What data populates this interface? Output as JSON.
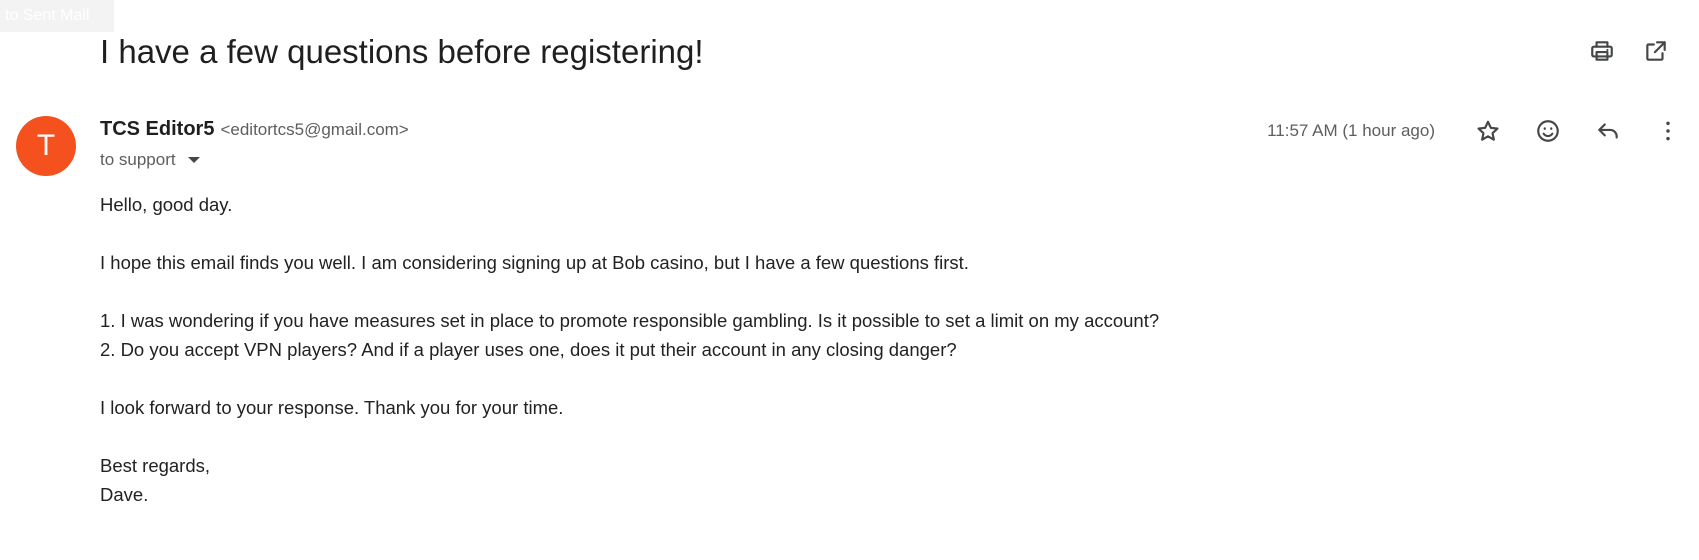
{
  "folder_label": "to Sent Mail",
  "subject": "I have a few questions before registering!",
  "top_actions": {
    "print_icon": "print-icon",
    "popout_icon": "open-in-new-window-icon"
  },
  "sender": {
    "avatar_initial": "T",
    "avatar_color": "#f4511e",
    "name": "TCS Editor5",
    "email": "<editortcs5@gmail.com>"
  },
  "recipient": "to support",
  "timestamp": "11:57 AM (1 hour ago)",
  "message_actions": [
    "star-icon",
    "emoji-reaction-icon",
    "reply-icon",
    "more-vert-icon"
  ],
  "body": {
    "greeting": "Hello, good day.",
    "intro": "I hope this email finds you well. I am considering signing up at  Bob casino, but I have a few questions first.",
    "q1": "1. I was wondering if you have measures set in place to promote responsible gambling. Is it possible to set a limit on my account?",
    "q2": "2. Do you accept VPN players? And if a player uses one, does it put their account in any closing danger?",
    "closing": "I look forward to your response. Thank you for your time.",
    "signoff": "Best regards,",
    "signature": "Dave."
  }
}
